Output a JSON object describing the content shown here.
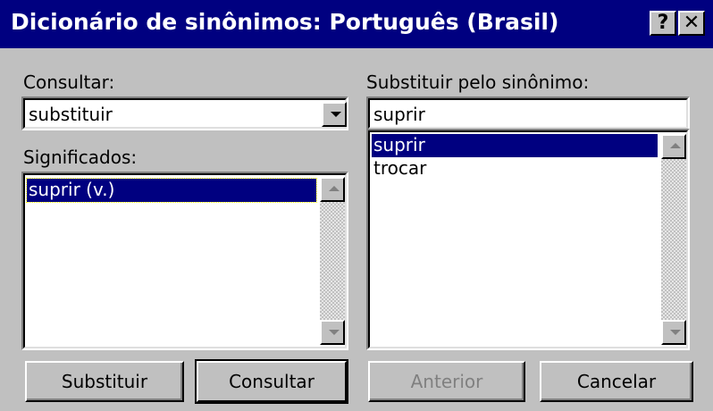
{
  "window": {
    "title": "Dicionário de sinônimos: Português (Brasil)",
    "help_label": "?",
    "close_label": "✕"
  },
  "consultar": {
    "label": "Consultar:",
    "value": "substituir"
  },
  "significados": {
    "label": "Significados:",
    "items": [
      "suprir (v.)"
    ],
    "selected_index": 0
  },
  "substituir": {
    "label": "Substituir pelo sinônimo:",
    "value": "suprir",
    "items": [
      "suprir",
      "trocar"
    ],
    "selected_index": 0
  },
  "buttons": {
    "substituir": "Substituir",
    "consultar": "Consultar",
    "anterior": "Anterior",
    "cancelar": "Cancelar"
  },
  "colors": {
    "titlebar": "#000080",
    "face": "#c0c0c0",
    "selection": "#000080"
  }
}
